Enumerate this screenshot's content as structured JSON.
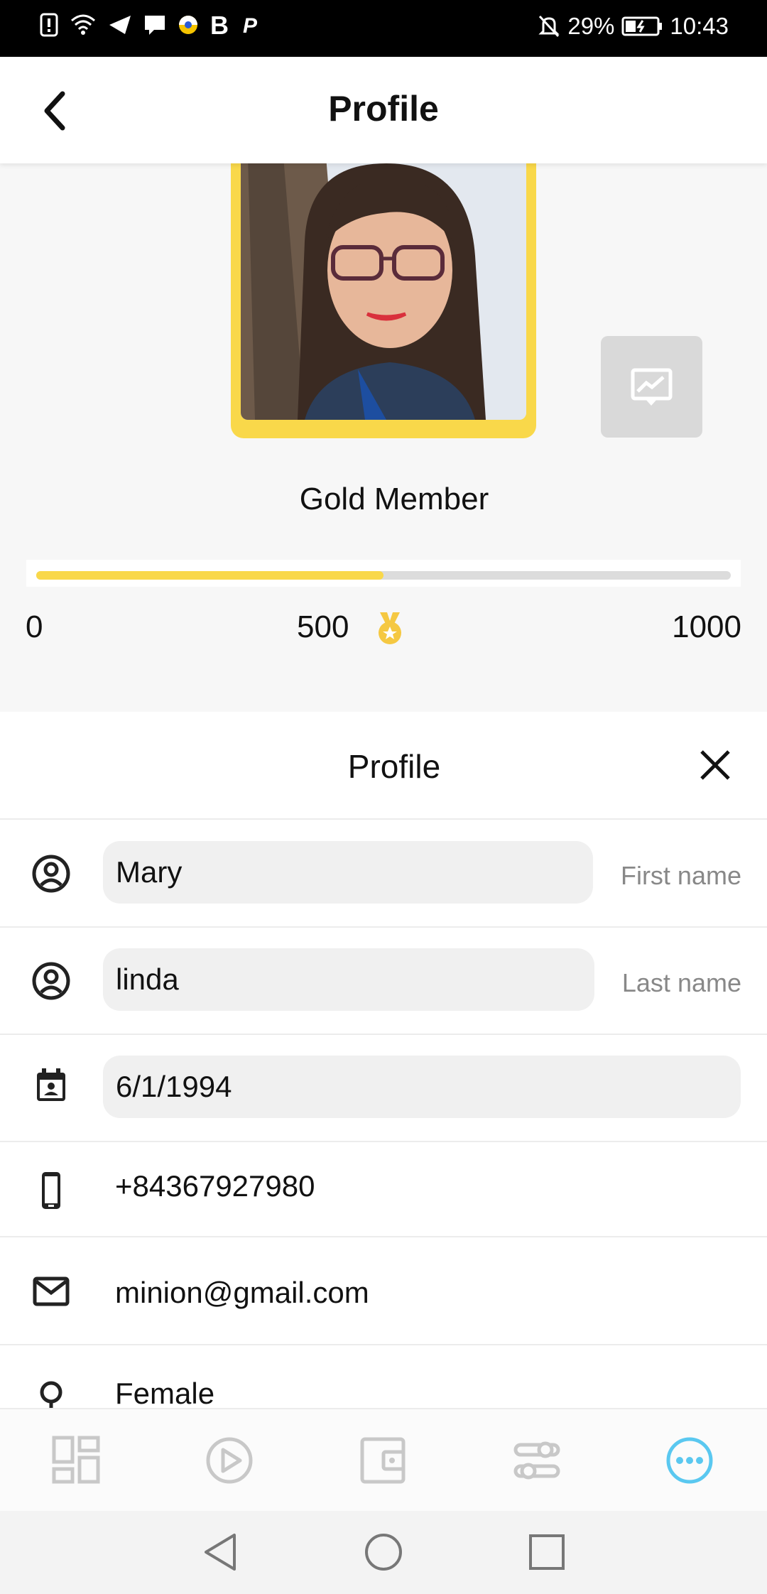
{
  "status_bar": {
    "battery_percent": "29%",
    "time": "10:43",
    "icons": [
      "alert-icon",
      "wifi-icon",
      "send-icon",
      "message-icon",
      "pokeball-icon",
      "b-app-icon",
      "p-app-icon",
      "mute-icon",
      "battery-icon"
    ]
  },
  "app_bar": {
    "title": "Profile",
    "back_icon": "chevron-left-icon"
  },
  "membership": {
    "tier": "Gold Member",
    "points_progress": 0.5,
    "scale_min": "0",
    "scale_mid": "500",
    "scale_max": "1000",
    "medal_icon": "medal-icon",
    "share_icon": "image-share-icon",
    "accent_color": "#f9d84a"
  },
  "profile_panel": {
    "title": "Profile",
    "close_icon": "close-icon",
    "first_name": {
      "value": "Mary",
      "hint": "First name",
      "icon": "user-circle-icon"
    },
    "last_name": {
      "value": "linda",
      "hint": "Last name",
      "icon": "user-circle-icon"
    },
    "birthday": {
      "value": "6/1/1994",
      "icon": "calendar-icon"
    },
    "phone": {
      "value": "+84367927980",
      "icon": "phone-icon"
    },
    "email": {
      "value": "minion@gmail.com",
      "icon": "mail-icon"
    },
    "gender": {
      "value": "Female",
      "icon": "gender-icon"
    }
  },
  "bottom_nav": {
    "items": [
      "dashboard-icon",
      "play-icon",
      "wallet-icon",
      "settings-sliders-icon",
      "more-icon"
    ],
    "active_index": 4,
    "active_color": "#5ac8f0"
  },
  "system_nav": [
    "back-triangle-icon",
    "home-circle-icon",
    "recents-square-icon"
  ]
}
